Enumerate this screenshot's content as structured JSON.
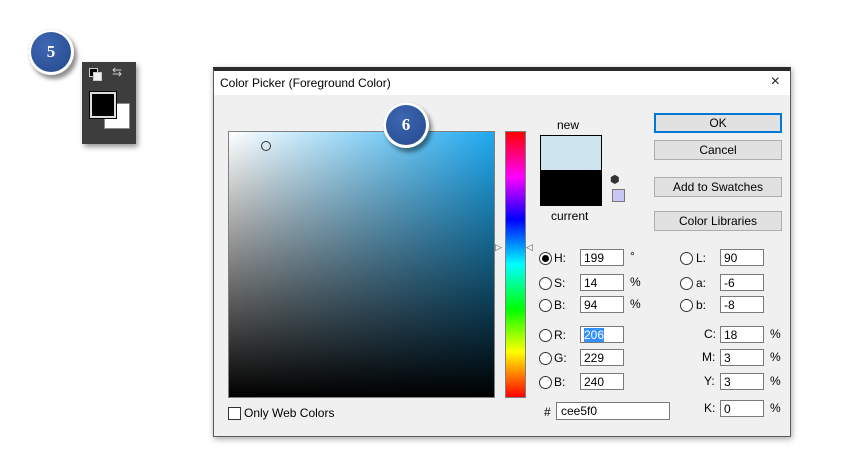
{
  "badges": {
    "step5": "5",
    "step6": "6"
  },
  "dialog": {
    "title": "Color Picker (Foreground Color)",
    "close_glyph": "×",
    "preview": {
      "new_label": "new",
      "current_label": "current",
      "new_color": "#cee5f0",
      "current_color": "#000000"
    },
    "buttons": {
      "ok": "OK",
      "cancel": "Cancel",
      "add_swatches": "Add to Swatches",
      "color_libraries": "Color Libraries"
    },
    "hsb": {
      "h": {
        "label": "H:",
        "value": "199",
        "unit": "°",
        "selected": true
      },
      "s": {
        "label": "S:",
        "value": "14",
        "unit": "%"
      },
      "b": {
        "label": "B:",
        "value": "94",
        "unit": "%"
      }
    },
    "rgb": {
      "r": {
        "label": "R:",
        "value": "206"
      },
      "g": {
        "label": "G:",
        "value": "229"
      },
      "b": {
        "label": "B:",
        "value": "240"
      }
    },
    "lab": {
      "l": {
        "label": "L:",
        "value": "90"
      },
      "a": {
        "label": "a:",
        "value": "-6"
      },
      "b": {
        "label": "b:",
        "value": "-8"
      }
    },
    "cmyk": {
      "c": {
        "label": "C:",
        "value": "18",
        "unit": "%"
      },
      "m": {
        "label": "M:",
        "value": "3",
        "unit": "%"
      },
      "y": {
        "label": "Y:",
        "value": "3",
        "unit": "%"
      },
      "k": {
        "label": "K:",
        "value": "0",
        "unit": "%"
      }
    },
    "hex": {
      "prefix": "#",
      "value": "cee5f0"
    },
    "web_only": {
      "label": "Only Web Colors",
      "checked": false
    }
  }
}
